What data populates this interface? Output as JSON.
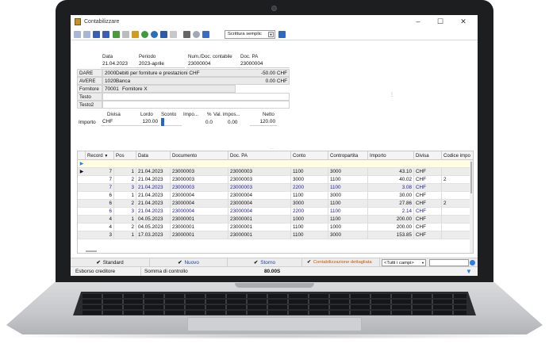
{
  "window": {
    "title": "Contabilizzare",
    "minimize": "–",
    "maximize": "☐",
    "close": "✕"
  },
  "toolbar": {
    "mode_select": "Scrittura semplic"
  },
  "header": {
    "cols": {
      "data": "Data",
      "periodo": "Periodo",
      "num_doc": "Num./Doc. contabile",
      "doc_pa": "Doc. PA"
    },
    "data": "21.04.2023",
    "periodo": "2023-aprile",
    "num_doc": "23000004",
    "doc_pa": "23000004"
  },
  "accounts": {
    "dare": {
      "label": "DARE",
      "code": "2000",
      "name": "Debiti per forniture e prestazioni CHF",
      "amount": "-50.00 CHF"
    },
    "avere": {
      "label": "AVERE",
      "code": "1020",
      "name": "Banca",
      "amount": "0.00 CHF"
    },
    "fornitore": {
      "label": "Fornitore",
      "code": "70001",
      "name": "Fornitore X"
    },
    "testo": {
      "label": "Testo"
    },
    "testo2": {
      "label": "Testo2"
    }
  },
  "amounts": {
    "cols": {
      "divisa": "Divisa",
      "lordo": "Lordo",
      "sconto": "Sconto",
      "impo": "Impo...",
      "pct": "%",
      "val_impo": "Val. impos...",
      "netto": "Netto"
    },
    "row_label": "Importo",
    "divisa": "CHF",
    "lordo": "120.00",
    "pct": "0.0",
    "val_impo": "0.00",
    "netto": "120.00"
  },
  "grid": {
    "columns": [
      "Record",
      "Pos",
      "Data",
      "Documento",
      "Doc. PA",
      "Conto",
      "Contropartita",
      "Importo",
      "Divisa",
      "Codice impo"
    ],
    "rows": [
      {
        "record": "7",
        "pos": "1",
        "data": "21.04.2023",
        "documento": "23000003",
        "doc_pa": "23000003",
        "conto": "1100",
        "contropartita": "3000",
        "importo": "43.10",
        "divisa": "CHF",
        "codice": ""
      },
      {
        "record": "7",
        "pos": "2",
        "data": "21.04.2023",
        "documento": "23000003",
        "doc_pa": "23000003",
        "conto": "3000",
        "contropartita": "1100",
        "importo": "40.02",
        "divisa": "CHF",
        "codice": "2"
      },
      {
        "record": "7",
        "pos": "3",
        "data": "21.04.2023",
        "documento": "23000003",
        "doc_pa": "23000003",
        "conto": "2200",
        "contropartita": "1100",
        "importo": "3.08",
        "divisa": "CHF",
        "codice": ""
      },
      {
        "record": "6",
        "pos": "1",
        "data": "21.04.2023",
        "documento": "23000004",
        "doc_pa": "23000004",
        "conto": "1100",
        "contropartita": "3000",
        "importo": "30.00",
        "divisa": "CHF",
        "codice": ""
      },
      {
        "record": "6",
        "pos": "2",
        "data": "21.04.2023",
        "documento": "23000004",
        "doc_pa": "23000004",
        "conto": "3000",
        "contropartita": "1100",
        "importo": "27.86",
        "divisa": "CHF",
        "codice": "2"
      },
      {
        "record": "6",
        "pos": "3",
        "data": "21.04.2023",
        "documento": "23000004",
        "doc_pa": "23000004",
        "conto": "2200",
        "contropartita": "1100",
        "importo": "2.14",
        "divisa": "CHF",
        "codice": ""
      },
      {
        "record": "4",
        "pos": "1",
        "data": "04.05.2023",
        "documento": "23000001",
        "doc_pa": "23000001",
        "conto": "1000",
        "contropartita": "1100",
        "importo": "200.00",
        "divisa": "CHF",
        "codice": ""
      },
      {
        "record": "4",
        "pos": "2",
        "data": "04.05.2023",
        "documento": "23000001",
        "doc_pa": "23000001",
        "conto": "1100",
        "contropartita": "1000",
        "importo": "200.00",
        "divisa": "CHF",
        "codice": ""
      },
      {
        "record": "3",
        "pos": "1",
        "data": "17.03.2023",
        "documento": "23000001",
        "doc_pa": "23000001",
        "conto": "1100",
        "contropartita": "3000",
        "importo": "153.85",
        "divisa": "CHF",
        "codice": ""
      }
    ]
  },
  "buttons": {
    "standard": "Standard",
    "nuovo": "Nuovo",
    "storno": "Storno",
    "dettagliata": "Contabilizzazione dettagliata",
    "filter": "<Tutti i campi>"
  },
  "status": {
    "left": "Esborso creditore",
    "somma_label": "Somma di controllo",
    "somma_value": "80.00S"
  }
}
